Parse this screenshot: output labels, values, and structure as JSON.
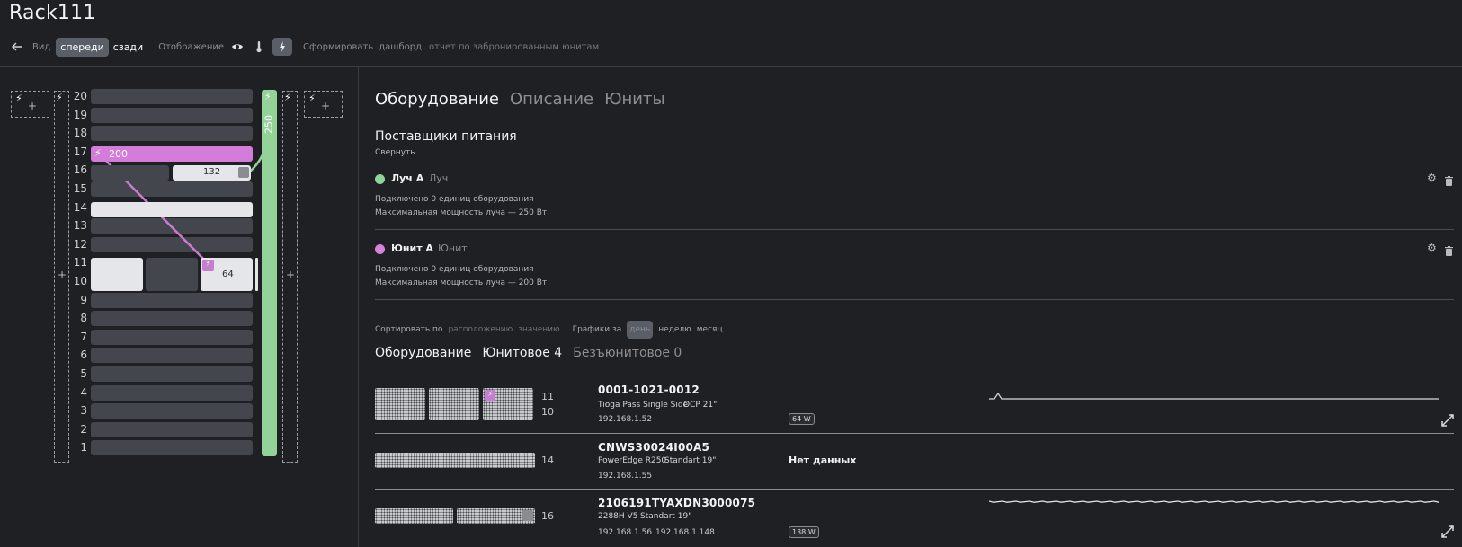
{
  "page": {
    "title": "Rack111"
  },
  "toolbar": {
    "view_label": "Вид",
    "front_label": "спереди",
    "back_label": "сзади",
    "display_label": "Отображение",
    "form_label": "Сформировать",
    "dashboard_label": "дашборд",
    "report_label": "отчет по забронированным юнитам"
  },
  "rack": {
    "units": [
      "20",
      "19",
      "18",
      "17",
      "16",
      "15",
      "14",
      "13",
      "12",
      "11",
      "10",
      "9",
      "8",
      "7",
      "6",
      "5",
      "4",
      "3",
      "2",
      "1"
    ],
    "pdu_value": "250",
    "device_17_value": "200",
    "device_16_value": "132",
    "device_1110_value": "64"
  },
  "tabs": [
    "Оборудование",
    "Описание",
    "Юниты"
  ],
  "power": {
    "title": "Поставщики питания",
    "collapse": "Свернуть",
    "providers": [
      {
        "name": "Луч A",
        "type": "Луч",
        "connected": "Подключено 0 единиц оборудования",
        "max": "Максимальная мощность луча — 250 Вт",
        "color": "#8fd39a"
      },
      {
        "name": "Юнит A",
        "type": "Юнит",
        "connected": "Подключено 0 единиц оборудования",
        "max": "Максимальная мощность луча — 200 Вт",
        "color": "#d483d8"
      }
    ]
  },
  "sort": {
    "label": "Сортировать по",
    "by_location": "расположению",
    "by_value": "значению",
    "graphs_label": "Графики за",
    "day": "день",
    "week": "неделю",
    "month": "месяц"
  },
  "equipment": {
    "title": "Оборудование",
    "unit_tab": "Юнитовое 4",
    "nounit_tab": "Безъюнитовое 0",
    "items": [
      {
        "id": "0001-1021-0012",
        "model": "Tioga Pass Single Side",
        "form": "OCP 21\"",
        "ip": "192.168.1.52",
        "ip2": "",
        "watt": "64 W",
        "units_top": "11",
        "units_bottom": "10",
        "nodata": ""
      },
      {
        "id": "CNWS30024I00A5",
        "model": "PowerEdge R250",
        "form": "Standart 19\"",
        "ip": "192.168.1.55",
        "ip2": "",
        "watt": "",
        "units_top": "14",
        "units_bottom": "",
        "nodata": "Нет данных"
      },
      {
        "id": "2106191TYAXDN3000075",
        "model": "2288H V5",
        "form": "Standart 19\"",
        "ip": "192.168.1.56",
        "ip2": "192.168.1.148",
        "watt": "138 W",
        "units_top": "16",
        "units_bottom": "",
        "nodata": ""
      }
    ]
  }
}
